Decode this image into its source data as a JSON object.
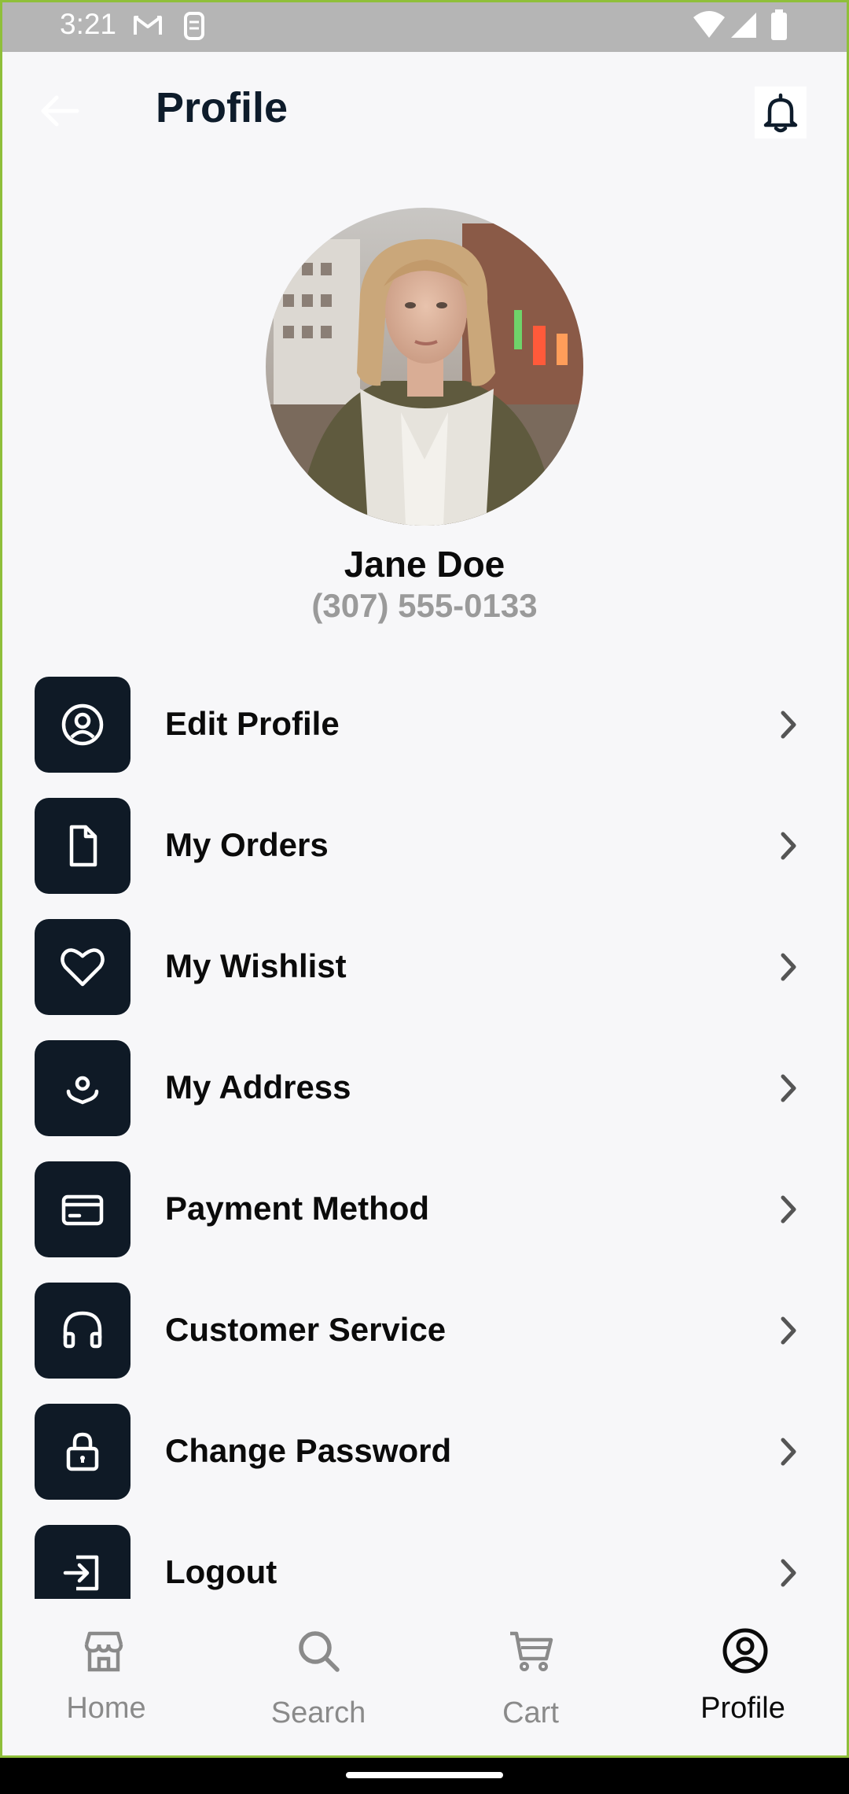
{
  "status_bar": {
    "time": "3:21",
    "icons": [
      "gmail-icon",
      "sim-icon",
      "wifi-icon",
      "signal-icon",
      "battery-icon"
    ]
  },
  "header": {
    "title": "Profile",
    "back_icon": "arrow-left-icon",
    "notification_icon": "bell-icon"
  },
  "profile": {
    "name": "Jane Doe",
    "phone": "(307) 555-0133"
  },
  "menu": {
    "items": [
      {
        "label": "Edit Profile",
        "icon": "user-circle-icon"
      },
      {
        "label": "My Orders",
        "icon": "document-icon"
      },
      {
        "label": "My Wishlist",
        "icon": "heart-icon"
      },
      {
        "label": "My Address",
        "icon": "location-icon"
      },
      {
        "label": "Payment Method",
        "icon": "credit-card-icon"
      },
      {
        "label": "Customer Service",
        "icon": "headphones-icon"
      },
      {
        "label": "Change Password",
        "icon": "lock-icon"
      },
      {
        "label": "Logout",
        "icon": "logout-icon"
      }
    ]
  },
  "bottom_nav": {
    "items": [
      {
        "label": "Home",
        "icon": "store-icon"
      },
      {
        "label": "Search",
        "icon": "search-icon"
      },
      {
        "label": "Cart",
        "icon": "cart-icon"
      },
      {
        "label": "Profile",
        "icon": "user-circle-icon"
      }
    ],
    "active": "Profile"
  },
  "colors": {
    "accent_dark": "#0f1a26",
    "background": "#f7f7f9",
    "muted_text": "#9a9a9a"
  }
}
